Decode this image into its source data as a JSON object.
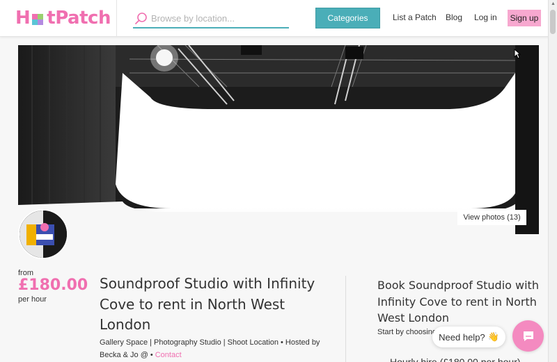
{
  "header": {
    "logo_text": "HotPatch",
    "logo_prefix": "H",
    "logo_suffix": "tPatch",
    "search_placeholder": "Browse by location...",
    "categories_label": "Categories",
    "nav": {
      "list_patch": "List a Patch",
      "blog": "Blog",
      "login": "Log in",
      "signup": "Sign up"
    }
  },
  "hero": {
    "view_photos_label": "View photos (13)"
  },
  "price": {
    "from_label": "from",
    "amount": "£180.00",
    "unit": "per hour"
  },
  "listing": {
    "title": "Soundproof Studio with Infinity Cove to rent in North West London",
    "categories": "Gallery Space | Photography Studio | Shoot Location",
    "hosted_by": "Hosted by Becka & Jo @",
    "contact_label": "Contact"
  },
  "booking": {
    "title": "Book Soundproof Studio with Infinity Cove to rent in North West London",
    "subtitle": "Start by choosing",
    "bottom_text": "Hourly hire (£180.00 per hour)"
  },
  "help": {
    "label": "Need help?",
    "emoji": "👋"
  },
  "colors": {
    "brand_pink": "#f06fb0",
    "teal": "#4aaeb8",
    "signup_pink": "#f7a8cf"
  }
}
